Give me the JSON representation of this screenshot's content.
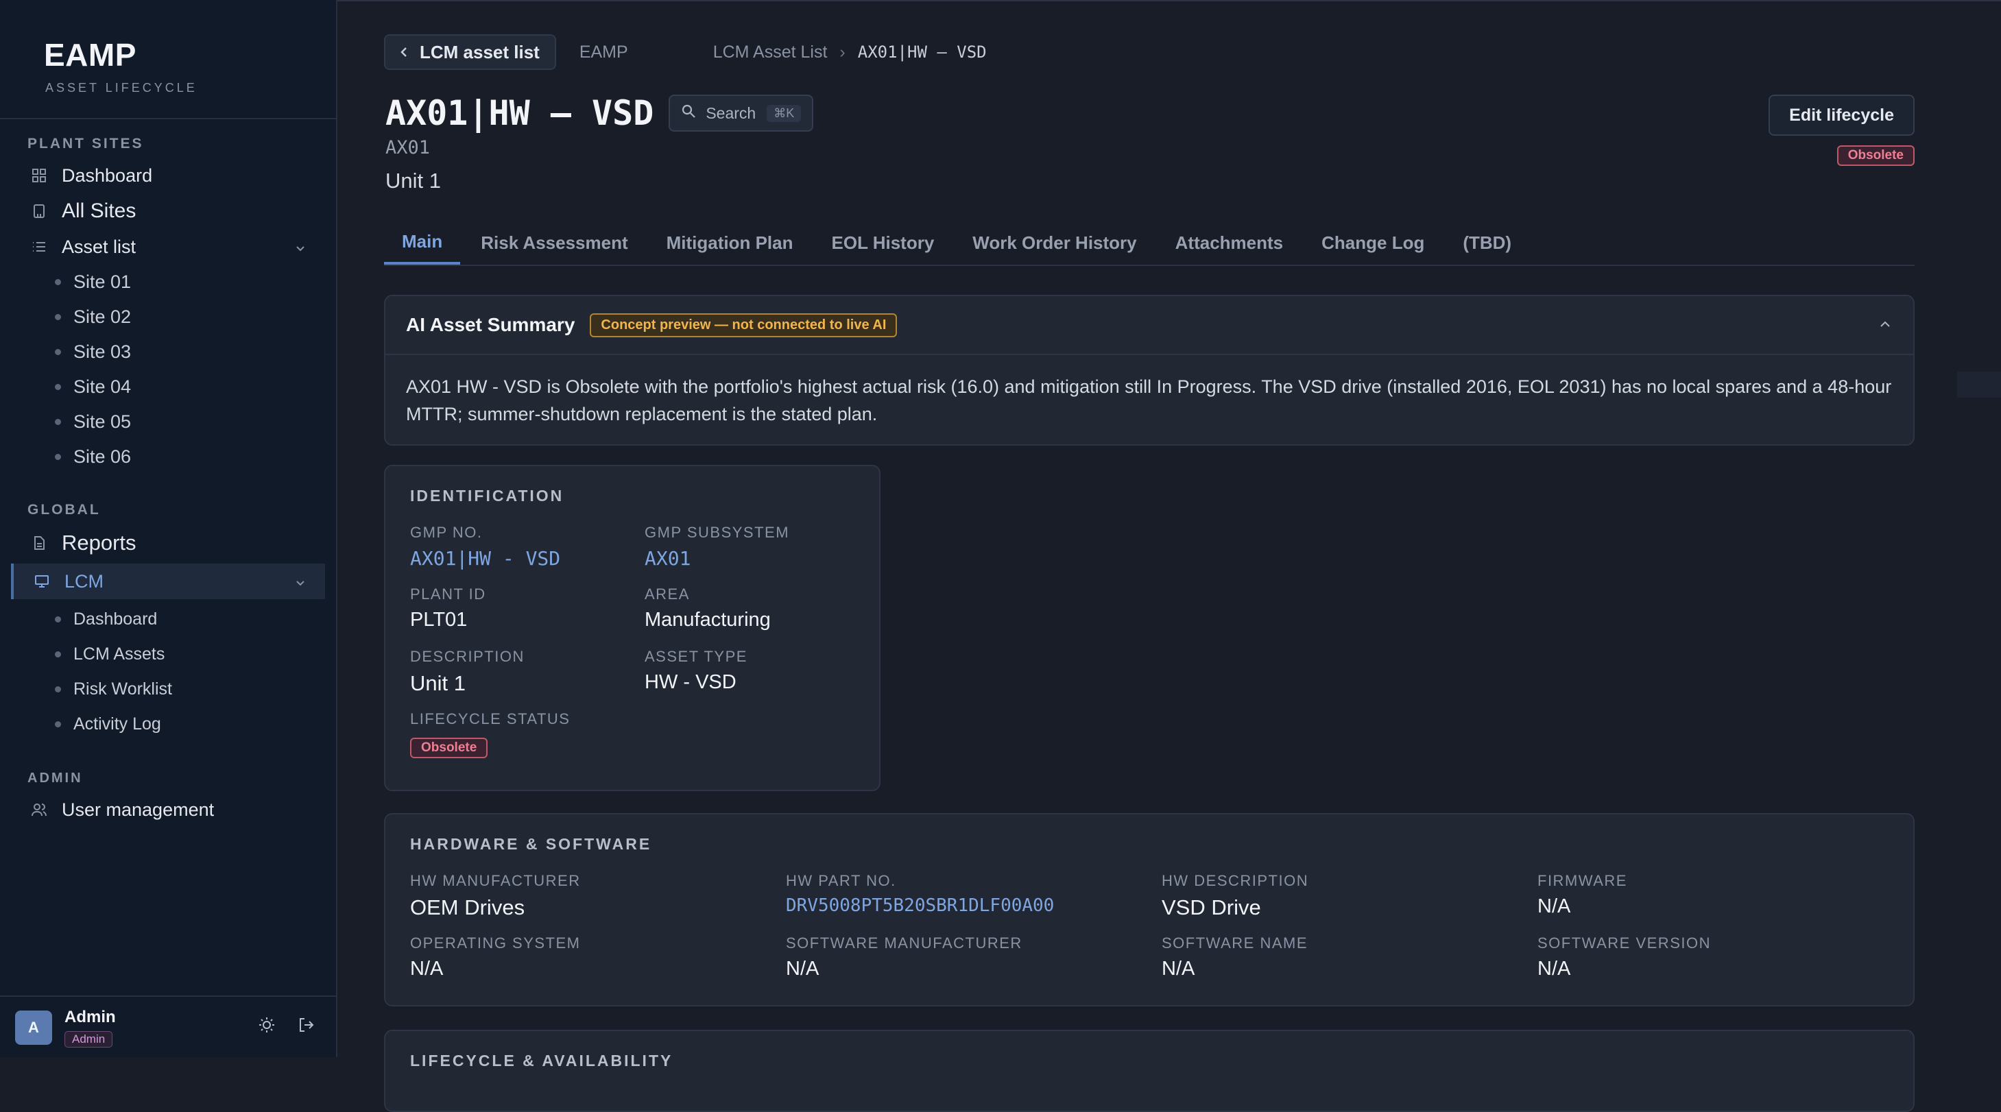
{
  "sidebar": {
    "brand_title": "EAMP",
    "brand_subtitle": "ASSET LIFECYCLE",
    "section_plant_sites": "PLANT SITES",
    "dashboard": "Dashboard",
    "all_sites": "All Sites",
    "asset_list": "Asset list",
    "sites": [
      "Site 01",
      "Site 02",
      "Site 03",
      "Site 04",
      "Site 05",
      "Site 06"
    ],
    "section_global": "GLOBAL",
    "reports": "Reports",
    "lcm": "LCM",
    "lcm_items": [
      "Dashboard",
      "LCM Assets",
      "Risk Worklist",
      "Activity Log"
    ],
    "section_admin": "ADMIN",
    "user_management": "User management",
    "user": {
      "initial": "A",
      "name": "Admin",
      "role": "Admin"
    }
  },
  "header": {
    "back_label": "LCM asset list",
    "crumb_root": "EAMP",
    "crumb_list": "LCM Asset List",
    "crumb_current": "AX01|HW – VSD",
    "title": "AX01|HW – VSD",
    "search_label": "Search",
    "search_shortcut": "⌘K",
    "code": "AX01",
    "description": "Unit 1",
    "edit_label": "Edit lifecycle",
    "status": "Obsolete"
  },
  "tabs": [
    "Main",
    "Risk Assessment",
    "Mitigation Plan",
    "EOL History",
    "Work Order History",
    "Attachments",
    "Change Log",
    "(TBD)"
  ],
  "ai_summary": {
    "title": "AI Asset Summary",
    "badge": "Concept preview — not connected to live AI",
    "text": "AX01 HW - VSD is Obsolete with the portfolio's highest actual risk (16.0) and mitigation still In Progress. The VSD drive (installed 2016, EOL 2031) has no local spares and a 48-hour MTTR; summer-shutdown replacement is the stated plan."
  },
  "identification": {
    "title": "IDENTIFICATION",
    "gmp_no_label": "GMP NO.",
    "gmp_no": "AX01|HW - VSD",
    "gmp_subsystem_label": "GMP SUBSYSTEM",
    "gmp_subsystem": "AX01",
    "plant_id_label": "PLANT ID",
    "plant_id": "PLT01",
    "area_label": "AREA",
    "area": "Manufacturing",
    "description_label": "DESCRIPTION",
    "description": "Unit 1",
    "asset_type_label": "ASSET TYPE",
    "asset_type": "HW - VSD",
    "lifecycle_status_label": "LIFECYCLE STATUS",
    "lifecycle_status": "Obsolete"
  },
  "hardware_software": {
    "title": "HARDWARE & SOFTWARE",
    "hw_manufacturer_label": "HW MANUFACTURER",
    "hw_manufacturer": "OEM Drives",
    "hw_part_no_label": "HW PART NO.",
    "hw_part_no": "DRV5008PT5B20SBR1DLF00A00",
    "hw_description_label": "HW DESCRIPTION",
    "hw_description": "VSD Drive",
    "firmware_label": "FIRMWARE",
    "firmware": "N/A",
    "os_label": "OPERATING SYSTEM",
    "os": "N/A",
    "sw_manufacturer_label": "SOFTWARE MANUFACTURER",
    "sw_manufacturer": "N/A",
    "sw_name_label": "SOFTWARE NAME",
    "sw_name": "N/A",
    "sw_version_label": "SOFTWARE VERSION",
    "sw_version": "N/A"
  },
  "lifecycle": {
    "title": "LIFECYCLE & AVAILABILITY"
  },
  "colors": {
    "background": "#181d28",
    "sidebar": "#111a28",
    "accent": "#7fa6e0",
    "obsolete": "#ef7f92",
    "ai_badge": "#f0b64d"
  }
}
